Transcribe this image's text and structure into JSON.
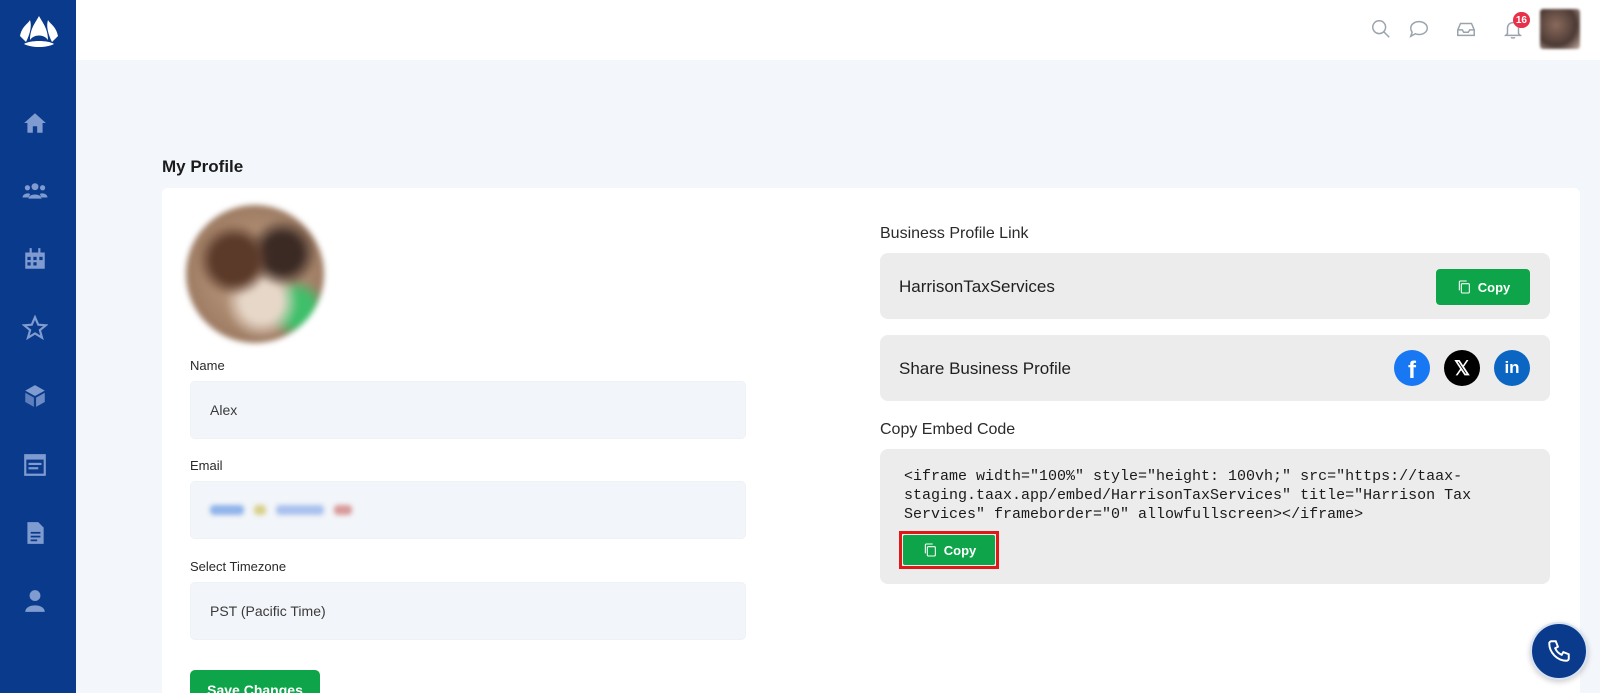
{
  "topbar": {
    "notification_count": "16"
  },
  "page": {
    "title": "My Profile"
  },
  "profile_form": {
    "name_label": "Name",
    "name_value": "Alex",
    "email_label": "Email",
    "timezone_label": "Select Timezone",
    "timezone_value": "PST (Pacific Time)",
    "save_label": "Save Changes"
  },
  "business": {
    "link_label": "Business Profile Link",
    "link_value": "HarrisonTaxServices",
    "copy_label": "Copy",
    "share_label": "Share Business Profile",
    "embed_label": "Copy Embed Code",
    "embed_code": "<iframe width=\"100%\" style=\"height: 100vh;\" src=\"https://taax-staging.taax.app/embed/HarrisonTaxServices\" title=\"Harrison Tax Services\" frameborder=\"0\" allowfullscreen></iframe>",
    "embed_copy_label": "Copy"
  },
  "colors": {
    "sidebar": "#0a3a8c",
    "primary_green": "#0ea54a",
    "badge_red": "#e8304a",
    "highlight_border": "#e01818"
  },
  "icons": {
    "sidebar": [
      "home-icon",
      "users-icon",
      "calendar-icon",
      "star-icon",
      "box-icon",
      "schedule-icon",
      "document-icon",
      "profile-icon"
    ],
    "topbar": [
      "search-icon",
      "chat-icon",
      "inbox-icon",
      "bell-icon"
    ],
    "social": [
      "facebook-icon",
      "x-icon",
      "linkedin-icon"
    ]
  }
}
